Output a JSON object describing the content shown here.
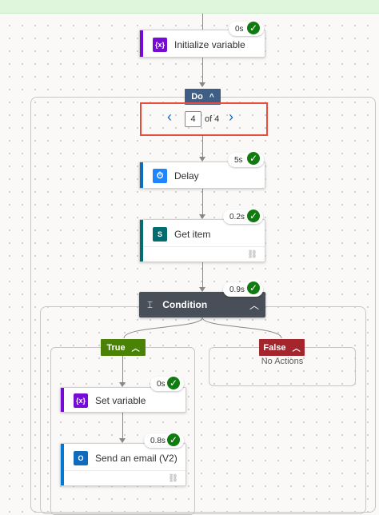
{
  "top_card": {
    "title": "Initialize variable",
    "icon_text": "{x}",
    "duration": "0s",
    "icon": "variable-icon",
    "accent": "#770bd6"
  },
  "do_scope": {
    "label": "Do",
    "chevron": "^"
  },
  "pager": {
    "current": "4",
    "of_text": "of 4",
    "prev": "‹",
    "next": "›",
    "highlight_color": "#e74c3c"
  },
  "delay_card": {
    "title": "Delay",
    "icon_text": "⏱",
    "duration": "5s",
    "icon": "timer-icon",
    "accent": "#0f6cbd"
  },
  "get_item_card": {
    "title": "Get item",
    "icon_text": "S",
    "duration": "0.2s",
    "icon": "sharepoint-icon",
    "accent": "#036c70"
  },
  "condition": {
    "title": "Condition",
    "icon_text": "⌶",
    "duration": "0.9s",
    "icon": "condition-icon",
    "header_color": "#484f58"
  },
  "true_branch": {
    "label": "True",
    "color": "#498205"
  },
  "false_branch": {
    "label": "False",
    "color": "#a4262c",
    "empty_text": "No Actions"
  },
  "set_variable_card": {
    "title": "Set variable",
    "icon_text": "{x}",
    "duration": "0s",
    "icon": "variable-icon",
    "accent": "#770bd6"
  },
  "send_email_card": {
    "title": "Send an email (V2)",
    "icon_text": "O",
    "duration": "0.8s",
    "icon": "outlook-icon",
    "accent": "#0078d4"
  },
  "link_icon": "⛓"
}
